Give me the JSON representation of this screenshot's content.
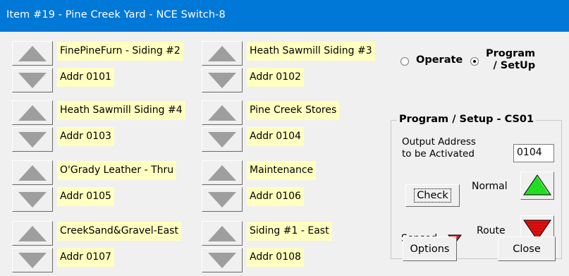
{
  "window": {
    "title": "Item #19 - Pine Creek Yard - NCE Switch-8"
  },
  "switches": [
    {
      "label": "FinePineFurn - Siding #2",
      "addr": "Addr 0101"
    },
    {
      "label": "Heath Sawmill Siding #3",
      "addr": "Addr 0102"
    },
    {
      "label": "Heath Sawmill Siding #4",
      "addr": "Addr 0103"
    },
    {
      "label": "Pine Creek Stores",
      "addr": "Addr 0104"
    },
    {
      "label": "O'Grady Leather - Thru",
      "addr": "Addr 0105"
    },
    {
      "label": "Maintenance",
      "addr": "Addr 0106"
    },
    {
      "label": "CreekSand&Gravel-East",
      "addr": "Addr 0107"
    },
    {
      "label": "Siding #1 - East",
      "addr": "Addr 0108"
    }
  ],
  "mode": {
    "operate_label": "Operate",
    "program_label_line1": "Program",
    "program_label_line2": "/ SetUp",
    "selected": "program"
  },
  "program_setup": {
    "group_title": "Program / Setup  -  CS01",
    "output_label_line1": "Output Address",
    "output_label_line2": "to be Activated",
    "output_value": "0104",
    "check_label": "Check",
    "normal_label": "Normal",
    "route_label": "Route",
    "sensed_label": "Sensed"
  },
  "buttons": {
    "options": "Options",
    "close": "Close"
  },
  "colors": {
    "title_bar": "#0078d7",
    "label_bg": "#ffffc0",
    "normal_arrow": "#22dd22",
    "route_arrow": "#dd1111",
    "sensed_arrow": "#ee1111",
    "arrow_gray": "#9e9e9e"
  },
  "icons": {
    "switch_up": "triangle-up-icon",
    "switch_down": "triangle-down-icon",
    "normal": "green-up-arrow-icon",
    "route": "red-down-arrow-icon",
    "sensed": "red-down-arrow-icon"
  }
}
